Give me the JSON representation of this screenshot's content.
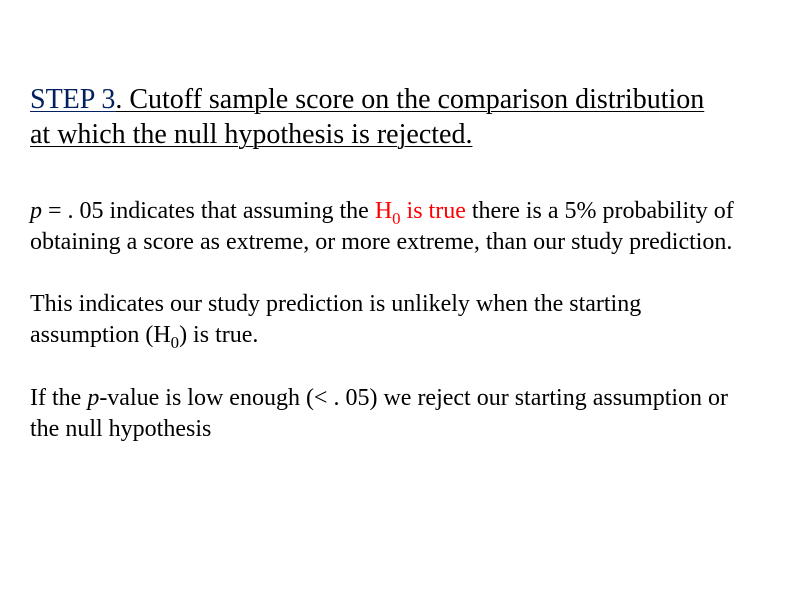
{
  "heading": {
    "step_label": "STEP 3",
    "text": ". Cutoff sample score on the comparison distribution at which the null hypothesis is rejected."
  },
  "para1": {
    "prefix_italic": "p",
    "t1": " = . 05 indicates that assuming the ",
    "h_letter": "H",
    "h_sub": "0",
    "t2": " is true",
    "t3": " there is a 5% probability of obtaining a score as extreme, or more extreme, than our study prediction."
  },
  "para2": {
    "t1": "This indicates our study prediction is unlikely when the starting assumption (",
    "h_letter": "H",
    "h_sub": "0",
    "t2": ") is true."
  },
  "para3": {
    "t1": "If the ",
    "pvalue_italic": "p",
    "t2": "-value is low enough (< . 05) we reject our starting assumption or the null hypothesis"
  }
}
